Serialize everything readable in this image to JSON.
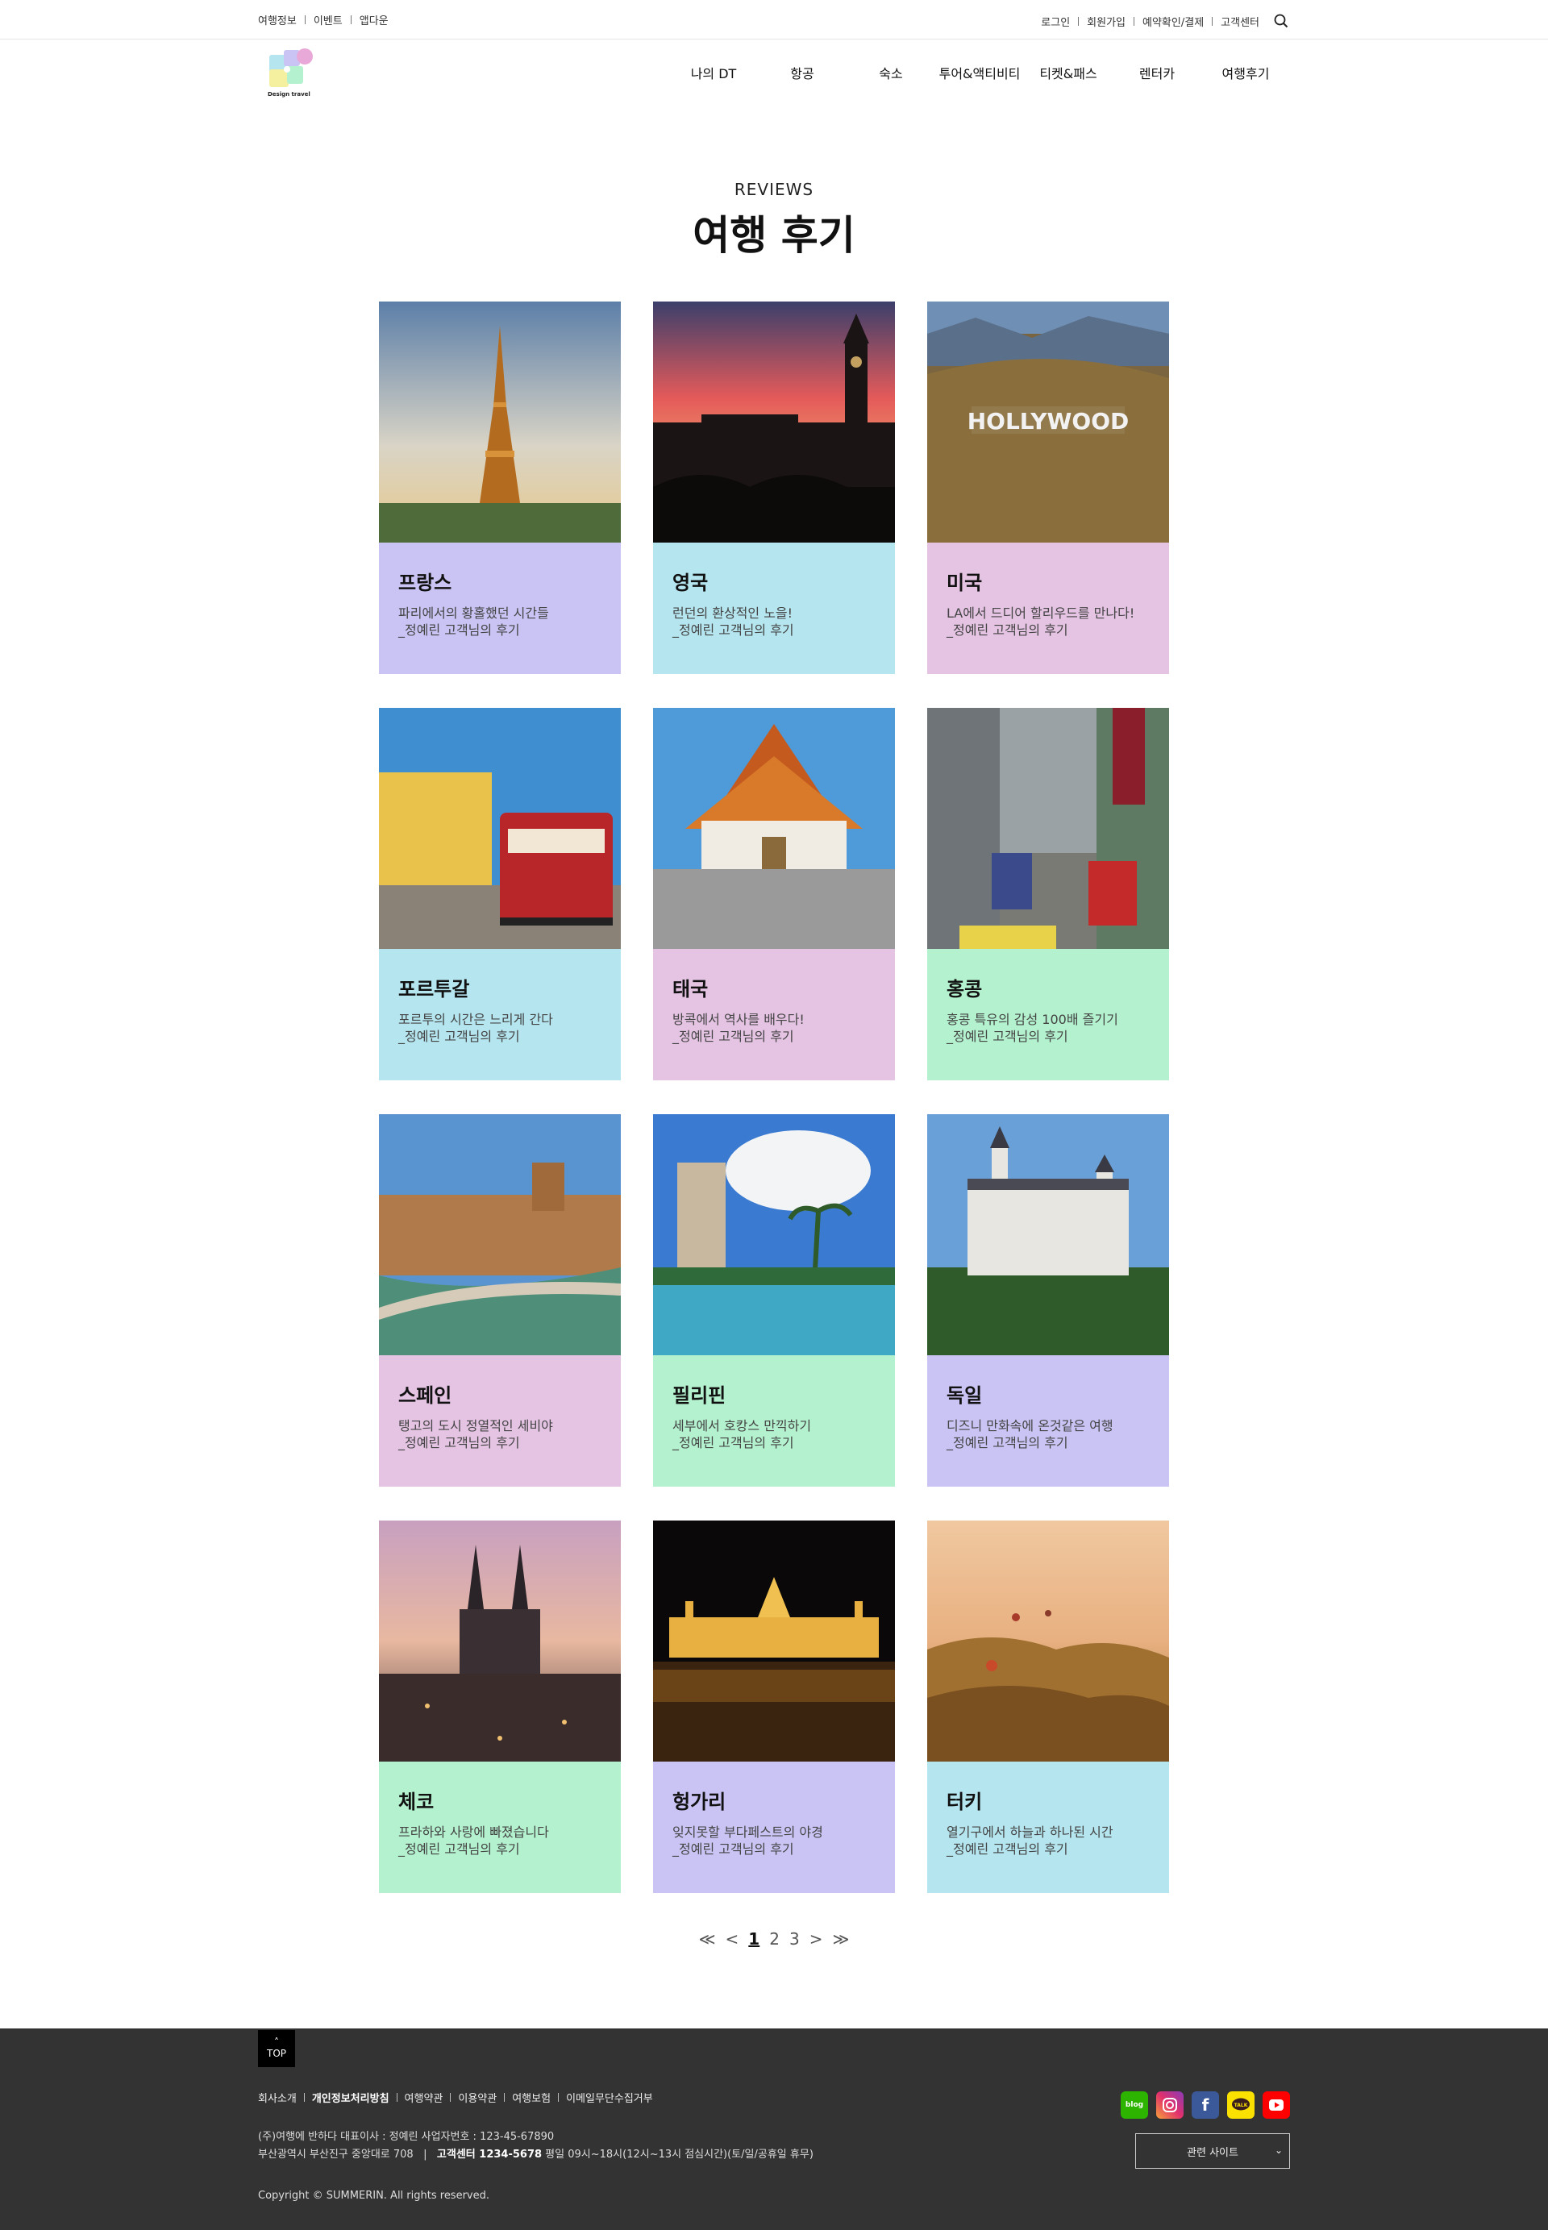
{
  "util": {
    "left": [
      "여행정보",
      "이벤트",
      "앱다운"
    ],
    "right": [
      "로그인",
      "회원가입",
      "예약확인/결제",
      "고객센터"
    ]
  },
  "logo": {
    "text": "Design travel"
  },
  "nav": [
    "나의 DT",
    "항공",
    "숙소",
    "투어&액티비티",
    "티켓&패스",
    "렌터카",
    "여행후기"
  ],
  "heading": {
    "sub": "REVIEWS",
    "title": "여행 후기"
  },
  "reviews": [
    {
      "country": "프랑스",
      "desc": "파리에서의 황홀했던 시간들",
      "author": "_정예린 고객님의 후기",
      "color": "#c9c4f4",
      "image": "eiffel-tower"
    },
    {
      "country": "영국",
      "desc": "런던의 환상적인 노을!",
      "author": "_정예린 고객님의 후기",
      "color": "#b5e5ef",
      "image": "big-ben-sunset"
    },
    {
      "country": "미국",
      "desc": "LA에서 드디어 할리우드를 만나다!",
      "author": "_정예린 고객님의 후기",
      "color": "#e4c3e3",
      "image": "hollywood-sign"
    },
    {
      "country": "포르투갈",
      "desc": "포르투의 시간은 느리게 간다",
      "author": "_정예린 고객님의 후기",
      "color": "#b5e5ef",
      "image": "lisbon-tram"
    },
    {
      "country": "태국",
      "desc": "방콕에서 역사를 배우다!",
      "author": "_정예린 고객님의 후기",
      "color": "#e4c3e3",
      "image": "bangkok-temple"
    },
    {
      "country": "홍콩",
      "desc": "홍콩 특유의 감성 100배 즐기기",
      "author": "_정예린 고객님의 후기",
      "color": "#b4f2cf",
      "image": "hongkong-street"
    },
    {
      "country": "스페인",
      "desc": "탱고의 도시 정열적인 세비야",
      "author": "_정예린 고객님의 후기",
      "color": "#e4c3e3",
      "image": "plaza-de-espana"
    },
    {
      "country": "필리핀",
      "desc": "세부에서 호캉스 만끽하기",
      "author": "_정예린 고객님의 후기",
      "color": "#b4f2cf",
      "image": "cebu-resort"
    },
    {
      "country": "독일",
      "desc": "디즈니 만화속에 온것같은 여행",
      "author": "_정예린 고객님의 후기",
      "color": "#c9c4f4",
      "image": "neuschwanstein"
    },
    {
      "country": "체코",
      "desc": "프라하와 사랑에 빠졌습니다",
      "author": "_정예린 고객님의 후기",
      "color": "#b4f2cf",
      "image": "prague-church"
    },
    {
      "country": "헝가리",
      "desc": "잊지못할 부다페스트의 야경",
      "author": "_정예린 고객님의 후기",
      "color": "#c9c4f4",
      "image": "budapest-parliament"
    },
    {
      "country": "터키",
      "desc": "열기구에서 하늘과 하나된 시간",
      "author": "_정예린 고객님의 후기",
      "color": "#b5e5ef",
      "image": "cappadocia-balloons"
    }
  ],
  "pagination": {
    "first": "≪",
    "prev": "<",
    "pages": [
      "1",
      "2",
      "3"
    ],
    "current": "1",
    "next": ">",
    "last": "≫"
  },
  "footer": {
    "top_button": "TOP",
    "links": [
      "회사소개",
      "개인정보처리방침",
      "여행약관",
      "이용약관",
      "여행보험",
      "이메일무단수집거부"
    ],
    "info_line1": "(주)여행에 반하다 대표이사 : 정예린 사업자번호 : 123-45-67890",
    "info_address": "부산광역시 부산진구 중앙대로 708",
    "info_cs_label": "고객센터 1234-5678",
    "info_hours": "평일 09시~18시(12시~13시 점심시간)(토/일/공휴일 휴무)",
    "copyright": "Copyright © SUMMERIN. All rights reserved.",
    "sns": [
      "blog",
      "instagram",
      "facebook",
      "kakaotalk",
      "youtube"
    ],
    "family_site": "관련 사이트"
  },
  "colors": {
    "footer_bg": "#333333",
    "lavender": "#c9c4f4",
    "sky": "#b5e5ef",
    "pink": "#e4c3e3",
    "mint": "#b4f2cf"
  }
}
